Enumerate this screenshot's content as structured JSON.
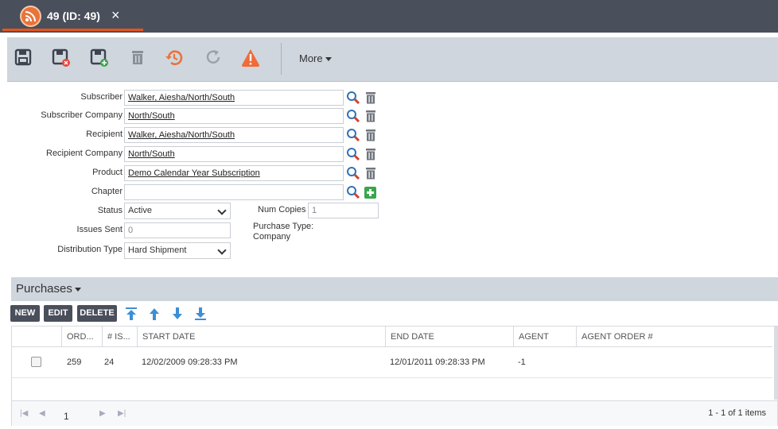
{
  "tab": {
    "title": "49 (ID: 49)",
    "close_icon": "×"
  },
  "toolbar": {
    "more_label": "More"
  },
  "form": {
    "subscriber": {
      "label": "Subscriber",
      "value": "Walker, Aiesha/North/South"
    },
    "subscriber_company": {
      "label": "Subscriber Company",
      "value": "North/South"
    },
    "recipient": {
      "label": "Recipient",
      "value": "Walker, Aiesha/North/South"
    },
    "recipient_company": {
      "label": "Recipient Company",
      "value": "North/South"
    },
    "product": {
      "label": "Product",
      "value": "Demo Calendar Year Subscription"
    },
    "chapter": {
      "label": "Chapter",
      "value": ""
    },
    "status": {
      "label": "Status",
      "value": "Active"
    },
    "num_copies": {
      "label": "Num Copies",
      "value": "1"
    },
    "issues_sent": {
      "label": "Issues Sent",
      "value": "0"
    },
    "purchase_type": {
      "label": "Purchase Type:",
      "value": "Company"
    },
    "distribution_type": {
      "label": "Distribution Type",
      "value": "Hard Shipment"
    }
  },
  "purchases": {
    "title": "Purchases",
    "buttons": {
      "new": "NEW",
      "edit": "EDIT",
      "delete": "DELETE"
    },
    "columns": [
      "ORD...",
      "# IS...",
      "START DATE",
      "END DATE",
      "AGENT",
      "AGENT ORDER #"
    ],
    "rows": [
      {
        "order": "259",
        "issues": "24",
        "start_date": "12/02/2009 09:28:33 PM",
        "end_date": "12/01/2011 09:28:33 PM",
        "agent": "-1",
        "agent_order": ""
      }
    ],
    "pager": {
      "page": "1",
      "info": "1 - 1 of 1 items"
    }
  },
  "colors": {
    "tabbar": "#4a4f5c",
    "toolbar": "#cfd6dd",
    "accent_orange": "#e8743b",
    "warning": "#f06a3a",
    "add_green": "#3aa54b"
  },
  "icons": [
    "rss-icon",
    "save-icon",
    "save-close-icon",
    "save-new-icon",
    "delete-icon",
    "history-icon",
    "refresh-icon",
    "warning-icon",
    "search-icon",
    "trash-icon",
    "add-icon",
    "move-top-icon",
    "move-up-icon",
    "move-down-icon",
    "move-bottom-icon"
  ]
}
